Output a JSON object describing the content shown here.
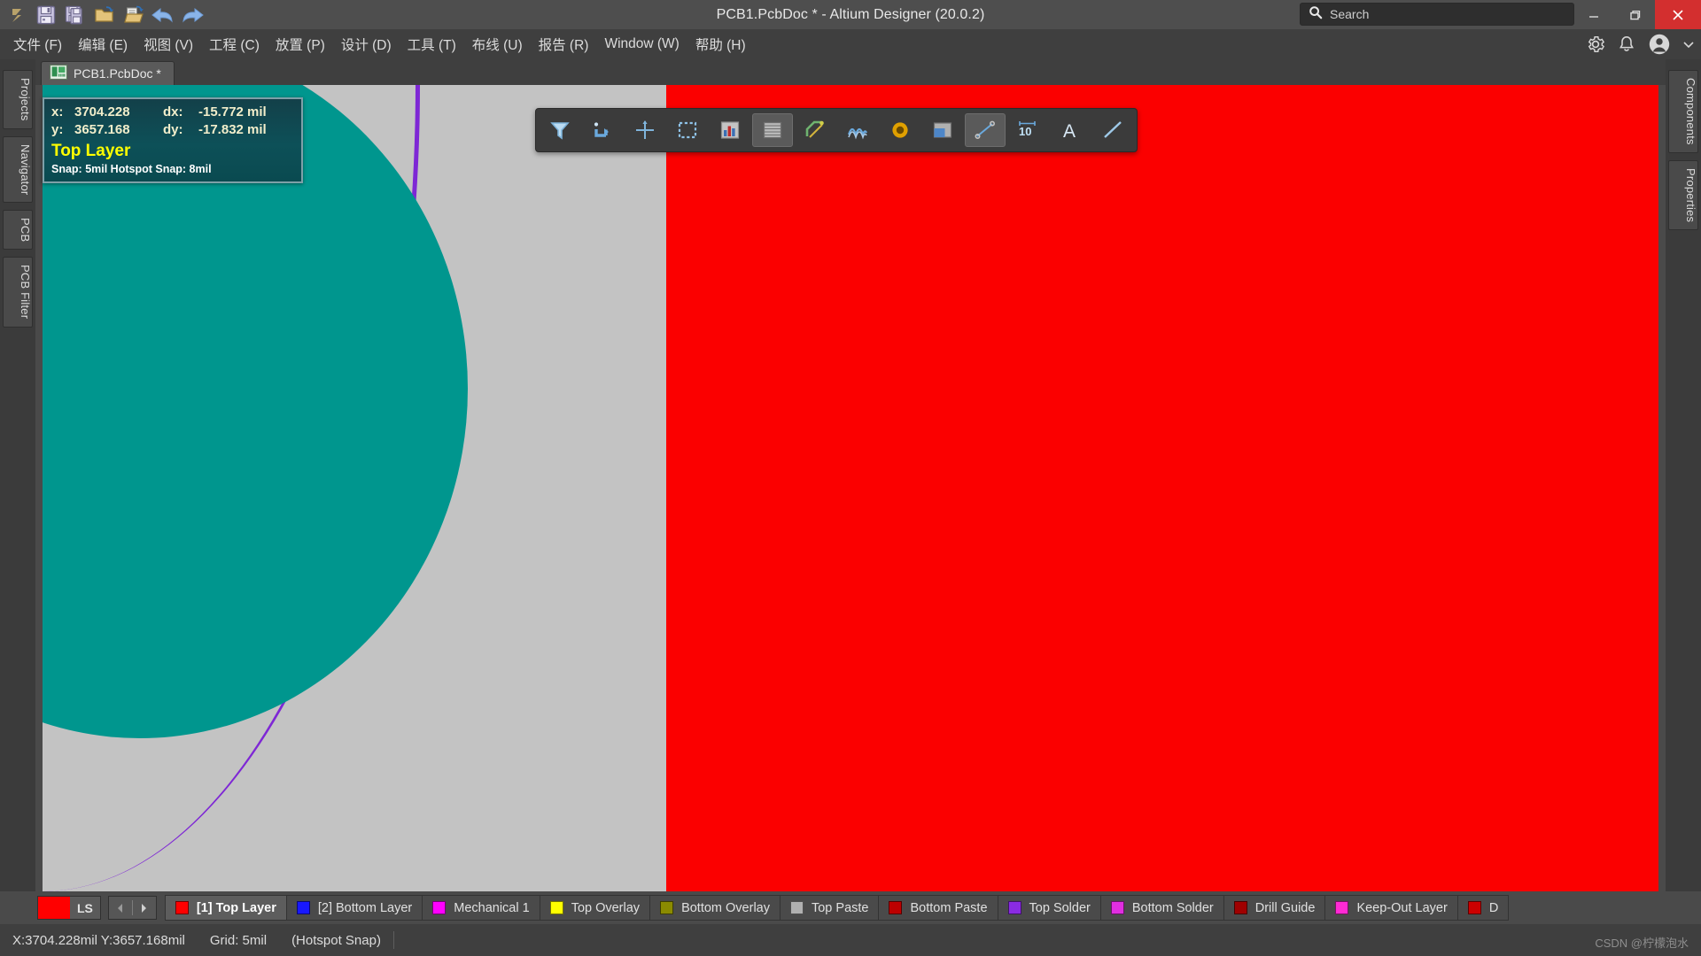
{
  "window": {
    "title": "PCB1.PcbDoc * - Altium Designer (20.0.2)",
    "minimize": "–",
    "maximize": "❐",
    "close": "✕"
  },
  "search": {
    "placeholder": "Search",
    "value": "",
    "icon": "search-icon"
  },
  "quick_access": [
    {
      "name": "altium-logo-icon",
      "label": "A"
    },
    {
      "name": "save-icon",
      "label": "Save"
    },
    {
      "name": "save-all-icon",
      "label": "Save All"
    },
    {
      "name": "open-icon",
      "label": "Open"
    },
    {
      "name": "open-document-icon",
      "label": "Open Document"
    },
    {
      "name": "undo-icon",
      "label": "Undo"
    },
    {
      "name": "redo-icon",
      "label": "Redo"
    }
  ],
  "menu": {
    "items": [
      {
        "label": "文件 (F)"
      },
      {
        "label": "编辑 (E)"
      },
      {
        "label": "视图 (V)"
      },
      {
        "label": "工程 (C)"
      },
      {
        "label": "放置 (P)"
      },
      {
        "label": "设计 (D)"
      },
      {
        "label": "工具 (T)"
      },
      {
        "label": "布线 (U)"
      },
      {
        "label": "报告 (R)"
      },
      {
        "label": "Window (W)"
      },
      {
        "label": "帮助 (H)"
      }
    ],
    "right_icons": [
      {
        "name": "settings-gear-icon"
      },
      {
        "name": "notifications-bell-icon"
      },
      {
        "name": "user-account-icon"
      },
      {
        "name": "chevron-down-icon"
      }
    ]
  },
  "left_rail": {
    "items": [
      {
        "label": "Projects"
      },
      {
        "label": "Navigator"
      },
      {
        "label": "PCB"
      },
      {
        "label": "PCB Filter"
      }
    ]
  },
  "right_rail": {
    "items": [
      {
        "label": "Components"
      },
      {
        "label": "Properties"
      }
    ]
  },
  "document_tabs": [
    {
      "label": "PCB1.PcbDoc *",
      "icon": "pcb-document-icon",
      "active": true
    }
  ],
  "toolbar": {
    "buttons": [
      {
        "name": "filter-icon",
        "tip": "Filter"
      },
      {
        "name": "snap-options-icon",
        "tip": "Snap Options"
      },
      {
        "name": "crosshair-icon",
        "tip": "Cross Probe"
      },
      {
        "name": "selection-box-icon",
        "tip": "Selection"
      },
      {
        "name": "bar-chart-icon",
        "tip": "Board Insight"
      },
      {
        "name": "plane-icon",
        "tip": "Plane / Polygon",
        "active": true
      },
      {
        "name": "route-track-icon",
        "tip": "Interactive Routing"
      },
      {
        "name": "differential-pair-icon",
        "tip": "Differential Pair Routing"
      },
      {
        "name": "via-pad-icon",
        "tip": "Place Via"
      },
      {
        "name": "fill-region-icon",
        "tip": "Place Fill"
      },
      {
        "name": "dimension-icon",
        "tip": "Place Dimension",
        "active": true
      },
      {
        "name": "measure-icon",
        "tip": "Measure"
      },
      {
        "name": "text-string-icon",
        "tip": "Place String"
      },
      {
        "name": "line-icon",
        "tip": "Place Line"
      }
    ]
  },
  "heads_up": {
    "x_key": "x:",
    "x_value": "3704.228",
    "dx_key": "dx:",
    "dx_value": "-15.772 mil",
    "y_key": "y:",
    "y_value": "3657.168",
    "dy_key": "dy:",
    "dy_value": "-17.832 mil",
    "layer": "Top Layer",
    "snap": "Snap: 5mil Hotspot Snap: 8mil"
  },
  "layer_bar": {
    "ls_label": "LS",
    "ls_color": "#ff0000",
    "prev_arrow": "◀",
    "next_arrow": "▶",
    "layers": [
      {
        "label": "[1] Top Layer",
        "color": "#ff0000",
        "selected": true
      },
      {
        "label": "[2] Bottom Layer",
        "color": "#1818ff",
        "selected": false
      },
      {
        "label": "Mechanical 1",
        "color": "#ff00ff",
        "selected": false
      },
      {
        "label": "Top Overlay",
        "color": "#ffff00",
        "selected": false
      },
      {
        "label": "Bottom Overlay",
        "color": "#8b8b00",
        "selected": false
      },
      {
        "label": "Top Paste",
        "color": "#b0b0b0",
        "selected": false
      },
      {
        "label": "Bottom Paste",
        "color": "#bd0000",
        "selected": false
      },
      {
        "label": "Top Solder",
        "color": "#8a2be2",
        "selected": false
      },
      {
        "label": "Bottom Solder",
        "color": "#e02ee0",
        "selected": false
      },
      {
        "label": "Drill Guide",
        "color": "#a00000",
        "selected": false
      },
      {
        "label": "Keep-Out Layer",
        "color": "#ff2ad4",
        "selected": false
      },
      {
        "label": "D",
        "color": "#cc0000",
        "selected": false
      }
    ]
  },
  "status_bar": {
    "coords": "X:3704.228mil Y:3657.168mil",
    "grid": "Grid: 5mil",
    "snap_mode": "(Hotspot Snap)"
  },
  "watermark": "CSDN @柠檬泡水"
}
